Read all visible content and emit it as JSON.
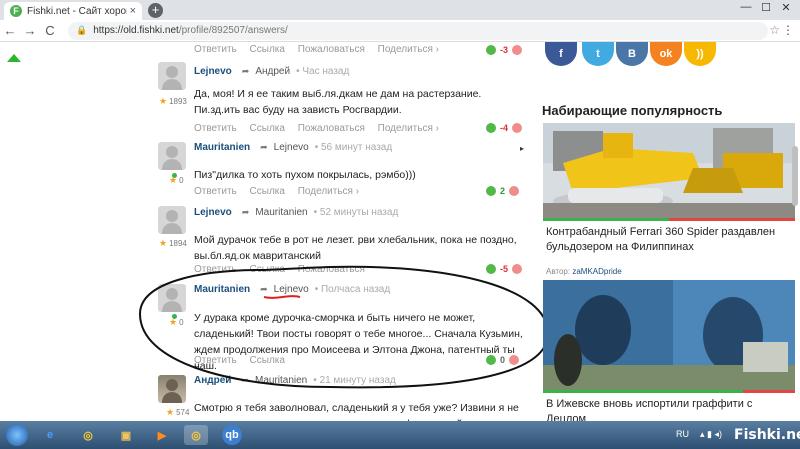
{
  "browser": {
    "tab_title": "Fishki.net - Сайт хорошего настр",
    "favicon_letter": "F",
    "tab_close": "×",
    "new_tab": "+",
    "win_min": "—",
    "win_max": "☐",
    "win_close": "✕",
    "back": "←",
    "forward": "→",
    "reload": "C",
    "lock": "🔒",
    "url_host": "https://old.fishki.net",
    "url_path": "/profile/892507/answers/",
    "star": "☆",
    "menu": "⋮"
  },
  "actions": {
    "reply": "Ответить",
    "link": "Ссылка",
    "report": "Пожаловаться",
    "share": "Поделиться ›"
  },
  "comments": [
    {
      "author": "Lejnevo",
      "to": "Андрей",
      "time": "• Час назад",
      "rating": "1893",
      "text": "Да, моя! И я ее таким выб.ля.дкам не дам на растерзание. Пи.зд.ить вас буду на зависть Росгвардии.",
      "score": "-4"
    },
    {
      "author": "Mauritanien",
      "to": "Lejnevo",
      "time": "• 56 минут назад",
      "rating": "0",
      "text": "Пиз\"дилка то хоть пухом покрылась, рэмбо)))",
      "score": "2"
    },
    {
      "author": "Lejnevo",
      "to": "Mauritanien",
      "time": "• 52 минуты назад",
      "rating": "1894",
      "text": "Мой дурачок тебе в рот не лезет. рви хлебальник, пока не поздно, вы.бл.яд.ок мавританский",
      "score": "-5"
    },
    {
      "author": "Mauritanien",
      "to": "Lejnevo",
      "time": "• Полчаса назад",
      "rating": "0",
      "text": "У дурака кроме дурочка-сморчка и быть ничего не может, сладенький! Твои посты говорят о тебе многое... Сначала Кузьмин, ждем продолжения про Моисеева и Элтона Джона, патентный ты наш.",
      "score": "0"
    },
    {
      "author": "Андрей",
      "to": "Mauritanien",
      "time": "• 21 минуту назад",
      "rating": "574",
      "text": "Смотрю я тебя заволновал, сладенький я у тебя уже? Извини я не из ваших, меня гомосятина не интересует, фантазируй о ком нибудь"
    }
  ],
  "top_score": "-3",
  "sidebar": {
    "title": "Набирающие популярность",
    "social": [
      "f",
      "t",
      "В",
      "ok",
      "))"
    ],
    "cards": [
      {
        "title": "Контрабандный Ferrari 360 Spider раздавлен бульдозером на Филиппинах",
        "author_label": "Автор:",
        "author": "zaMKADpride"
      },
      {
        "title": "В Ижевске вновь испортили граффити с Децлом"
      }
    ]
  },
  "taskbar": {
    "lang": "RU",
    "watermark": "Fishki.net",
    "icons": [
      "e",
      "◎",
      "▣",
      "▶",
      "◎",
      "qb"
    ]
  },
  "colors": {
    "accent_green": "#3ab14a",
    "link_blue": "#1a4f7d",
    "negative_red": "#e03030"
  }
}
